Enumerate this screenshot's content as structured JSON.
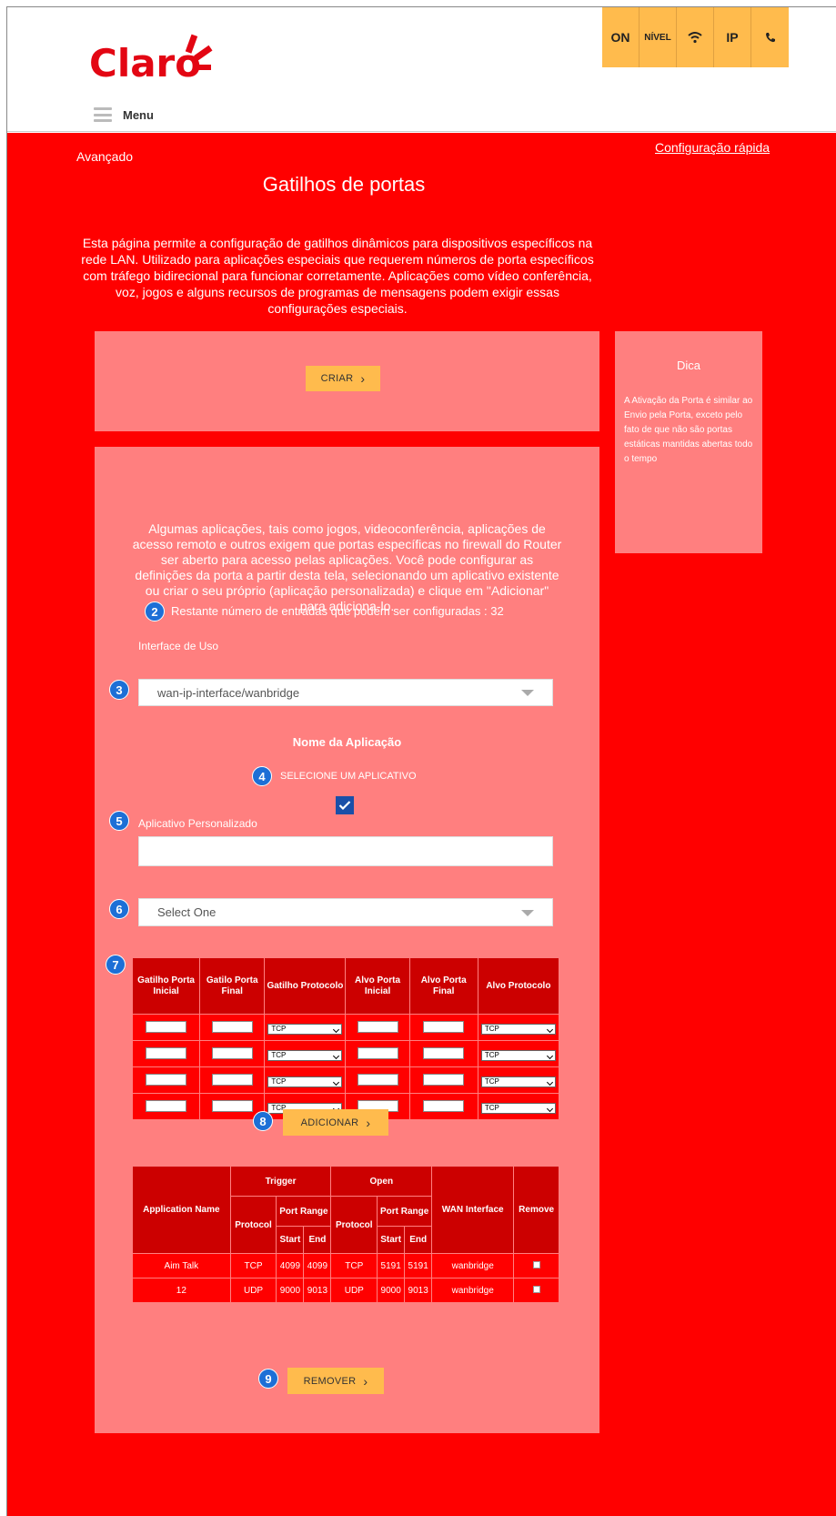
{
  "brand": {
    "logo_text": "Claro",
    "accent": "#ff0000",
    "panel": "#ff7f7f",
    "button": "#ffbb4d",
    "badge": "#1d6fd6"
  },
  "status": [
    {
      "label": "ON",
      "icon": ""
    },
    {
      "label": "NÍVEL",
      "icon": ""
    },
    {
      "label": "",
      "icon": "wifi-icon"
    },
    {
      "label": "IP",
      "icon": ""
    },
    {
      "label": "",
      "icon": "phone-icon"
    }
  ],
  "menu": {
    "label": "Menu"
  },
  "breadcrumb": "Avançado",
  "quick_config": "Configuração rápida",
  "page_title": "Gatilhos de portas",
  "intro": "Esta página permite a configuração de gatilhos dinâmicos para dispositivos específicos na rede LAN. Utilizado para aplicações especiais que requerem números de porta específicos com tráfego bidirecional para funcionar corretamente. Aplicações como vídeo conferência, voz, jogos e alguns recursos de programas de mensagens podem exigir essas configurações especiais.",
  "create_button": "CRIAR",
  "tip": {
    "title": "Dica",
    "text": "A Ativação da Porta é similar ao Envio pela Porta, exceto pelo fato de que não são portas estáticas mantidas abertas todo o tempo"
  },
  "main": {
    "description": "Algumas aplicações, tais como jogos, videoconferência, aplicações de acesso remoto e outros exigem que portas específicas no firewall do Router ser aberto para acesso pelas aplicações. Você pode configurar as definições da porta a partir desta tela, selecionando um aplicativo existente ou criar o seu próprio (aplicação personalizada) e clique em \"Adicionar\" para adiciona-lo.",
    "remaining": "Restante número de entradas que podem ser configuradas : 32",
    "interface_label": "Interface de Uso",
    "interface_value": "wan-ip-interface/wanbridge",
    "app_name_title": "Nome da Aplicação",
    "select_app_label": "SELECIONE UM APLICATIVO",
    "custom_app_label": "Aplicativo Personalizado",
    "custom_app_value": "",
    "app_select_value": "Select One",
    "add_button": "ADICIONAR",
    "remove_button": "REMOVER"
  },
  "badges": [
    "2",
    "3",
    "4",
    "5",
    "6",
    "7",
    "8",
    "9"
  ],
  "ports_table": {
    "headers": [
      "Gatilho Porta Inicial",
      "Gatilo Porta Final",
      "Gatilho Protocolo",
      "Alvo Porta Inicial",
      "Alvo Porta Final",
      "Alvo Protocolo"
    ],
    "rows": [
      {
        "trigger_protocol": "TCP",
        "target_protocol": "TCP"
      },
      {
        "trigger_protocol": "TCP",
        "target_protocol": "TCP"
      },
      {
        "trigger_protocol": "TCP",
        "target_protocol": "TCP"
      },
      {
        "trigger_protocol": "TCP",
        "target_protocol": "TCP"
      }
    ]
  },
  "apps_table": {
    "headers": {
      "application_name": "Application Name",
      "trigger": "Trigger",
      "open": "Open",
      "protocol": "Protocol",
      "port_range": "Port Range",
      "start": "Start",
      "end": "End",
      "wan_interface": "WAN Interface",
      "remove": "Remove"
    },
    "rows": [
      {
        "name": "Aim Talk",
        "t_proto": "TCP",
        "t_start": "4099",
        "t_end": "4099",
        "o_proto": "TCP",
        "o_start": "5191",
        "o_end": "5191",
        "wan": "wanbridge"
      },
      {
        "name": "12",
        "t_proto": "UDP",
        "t_start": "9000",
        "t_end": "9013",
        "o_proto": "UDP",
        "o_start": "9000",
        "o_end": "9013",
        "wan": "wanbridge"
      }
    ]
  }
}
